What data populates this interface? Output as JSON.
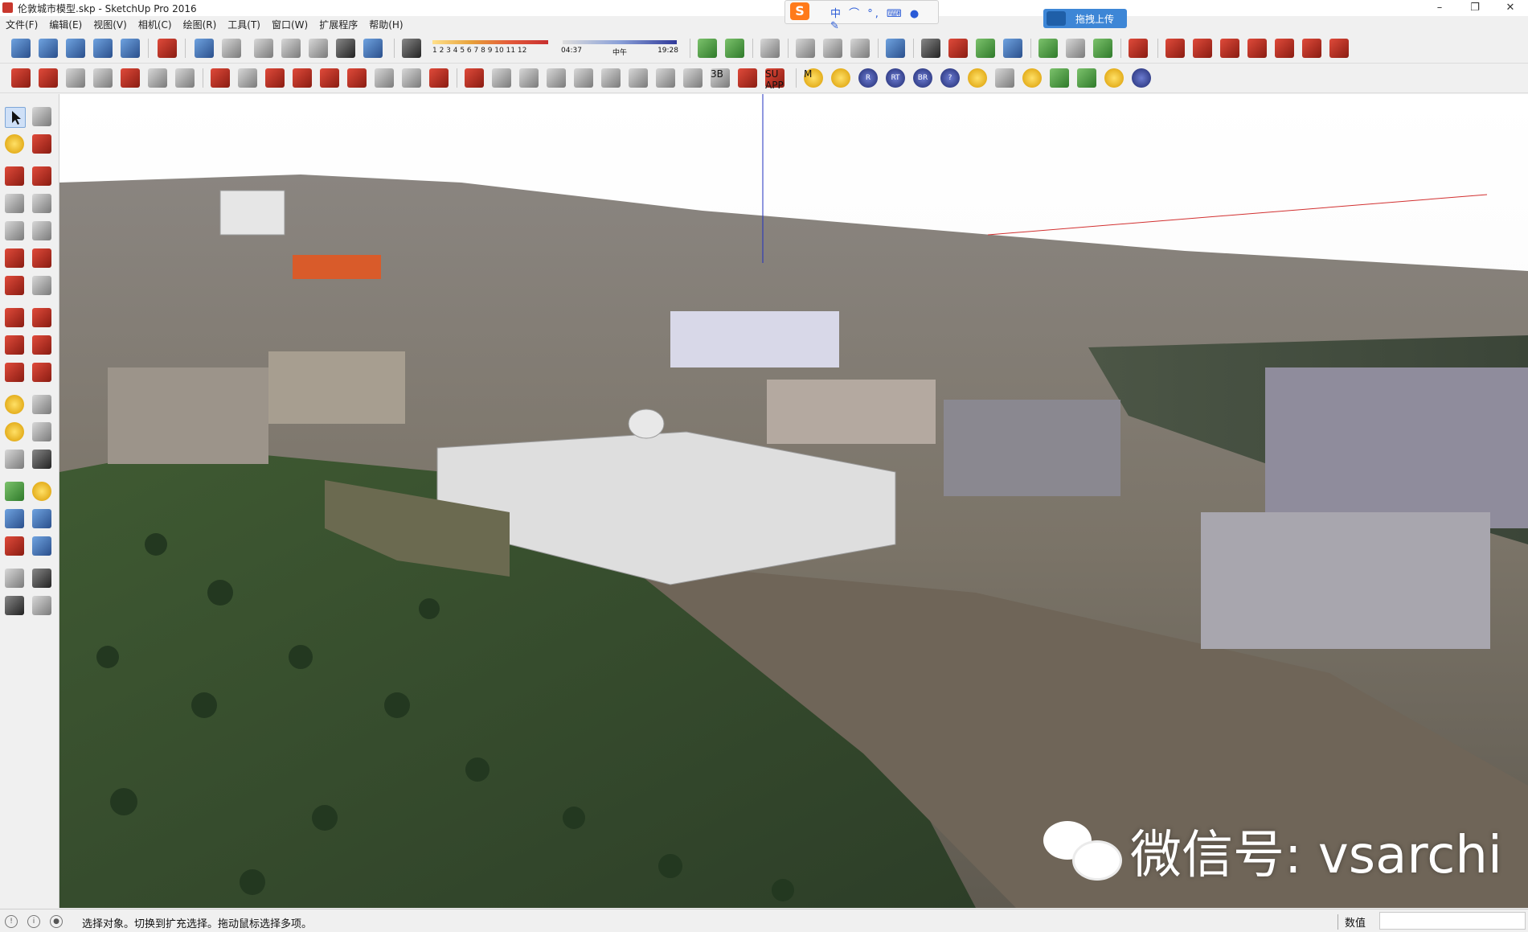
{
  "window": {
    "title": "伦敦城市模型.skp - SketchUp Pro 2016",
    "minimize": "–",
    "restore": "❐",
    "close": "✕"
  },
  "ime": {
    "label": "中 ⌒ °, ⌨ ● ✎"
  },
  "upload_button": {
    "label": "拖拽上传"
  },
  "menu": [
    "文件(F)",
    "编辑(E)",
    "视图(V)",
    "相机(C)",
    "绘图(R)",
    "工具(T)",
    "窗口(W)",
    "扩展程序",
    "帮助(H)"
  ],
  "shadow_settings": {
    "months": "1 2 3 4 5 6 7 8 9 10 11 12",
    "time_start": "04:37",
    "time_mid": "中午",
    "time_end": "19:28"
  },
  "toolbar_icons": {
    "labels": [
      "3B",
      "SU APP",
      "M",
      "R",
      "RT",
      "BR",
      "?"
    ]
  },
  "status": {
    "message": "选择对象。切换到扩充选择。拖动鼠标选择多项。",
    "value_label": "数值",
    "value": ""
  },
  "watermark": {
    "text": "微信号: vsarchi"
  },
  "colors": {
    "accent_upload": "#3d86d6",
    "ime_logo": "#ff7a1a",
    "axis_red": "#d23030",
    "axis_blue": "#2030c0"
  }
}
